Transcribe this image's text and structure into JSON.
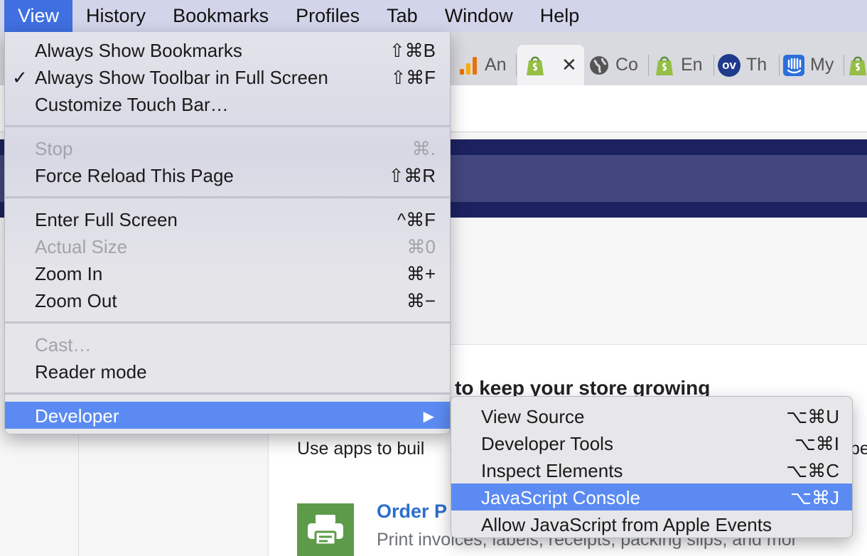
{
  "menubar": {
    "items": [
      "View",
      "History",
      "Bookmarks",
      "Profiles",
      "Tab",
      "Window",
      "Help"
    ]
  },
  "tabs": [
    {
      "label": "An",
      "icon": "bar-chart-icon"
    },
    {
      "label": "",
      "icon": "shopify-bag-icon",
      "close": "✕"
    },
    {
      "label": "Co",
      "icon": "globe-icon"
    },
    {
      "label": "En",
      "icon": "shopify-bag-icon"
    },
    {
      "label": "Th",
      "icon": "ov-logo-icon"
    },
    {
      "label": "My",
      "icon": "intercom-icon"
    }
  ],
  "ov_logo_text": "ov",
  "view_menu": {
    "items": [
      {
        "label": "Always Show Bookmarks",
        "shortcut": "⇧⌘B"
      },
      {
        "label": "Always Show Toolbar in Full Screen",
        "shortcut": "⇧⌘F",
        "check": "✓"
      },
      {
        "label": "Customize Touch Bar…",
        "shortcut": ""
      },
      {
        "label": "Stop",
        "shortcut": "⌘."
      },
      {
        "label": "Force Reload This Page",
        "shortcut": "⇧⌘R"
      },
      {
        "label": "Enter Full Screen",
        "shortcut": "^⌘F"
      },
      {
        "label": "Actual Size",
        "shortcut": "⌘0"
      },
      {
        "label": "Zoom In",
        "shortcut": "⌘+"
      },
      {
        "label": "Zoom Out",
        "shortcut": "⌘−"
      },
      {
        "label": "Cast…",
        "shortcut": ""
      },
      {
        "label": "Reader mode",
        "shortcut": ""
      },
      {
        "label": "Developer",
        "shortcut": "▶"
      }
    ]
  },
  "developer_menu": {
    "items": [
      {
        "label": "View Source",
        "shortcut": "⌥⌘U"
      },
      {
        "label": "Developer Tools",
        "shortcut": "⌥⌘I"
      },
      {
        "label": "Inspect Elements",
        "shortcut": "⌥⌘C"
      },
      {
        "label": "JavaScript Console",
        "shortcut": "⌥⌘J"
      },
      {
        "label": "Allow JavaScript from Apple Events",
        "shortcut": ""
      }
    ]
  },
  "page": {
    "heading": "to keep your store growing",
    "description": "Use apps to buil",
    "description_tail": "be",
    "app_title": "Order P",
    "app_desc": "Print invoices, labels, receipts, packing slips, and mor"
  },
  "colors": {
    "menu_highlight": "#5b8bf2",
    "menubar_active": "#3f6fe0",
    "page_header": "#1c2260",
    "app_icon_bg": "#5d9b4a",
    "link": "#2c6ecb"
  }
}
